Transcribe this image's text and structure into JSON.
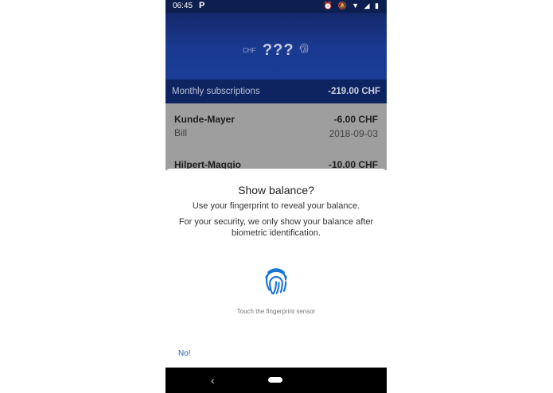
{
  "status_bar": {
    "time": "06:45",
    "app_indicator": "P",
    "icons": [
      "alarm-icon",
      "mute-icon",
      "wifi-icon",
      "signal-icon",
      "battery-icon"
    ]
  },
  "header": {
    "currency": "CHF",
    "balance_masked": "???"
  },
  "subscriptions": {
    "label": "Monthly subscriptions",
    "amount": "-219.00 CHF"
  },
  "transactions": [
    {
      "name": "Kunde-Mayer",
      "amount": "-6.00 CHF",
      "type": "Bill",
      "date": "2018-09-03"
    },
    {
      "name": "Hilpert-Maggio",
      "amount": "-10.00 CHF"
    }
  ],
  "dialog": {
    "title": "Show balance?",
    "subtitle": "Use your fingerprint to reveal your balance.",
    "description": "For your security, we only show your balance after biometric identification.",
    "hint": "Touch the fingerprint sensor",
    "negative_button": "No!"
  },
  "nav": {
    "back_glyph": "‹"
  },
  "colors": {
    "accent": "#1565c0",
    "header": "#1a3a92"
  }
}
